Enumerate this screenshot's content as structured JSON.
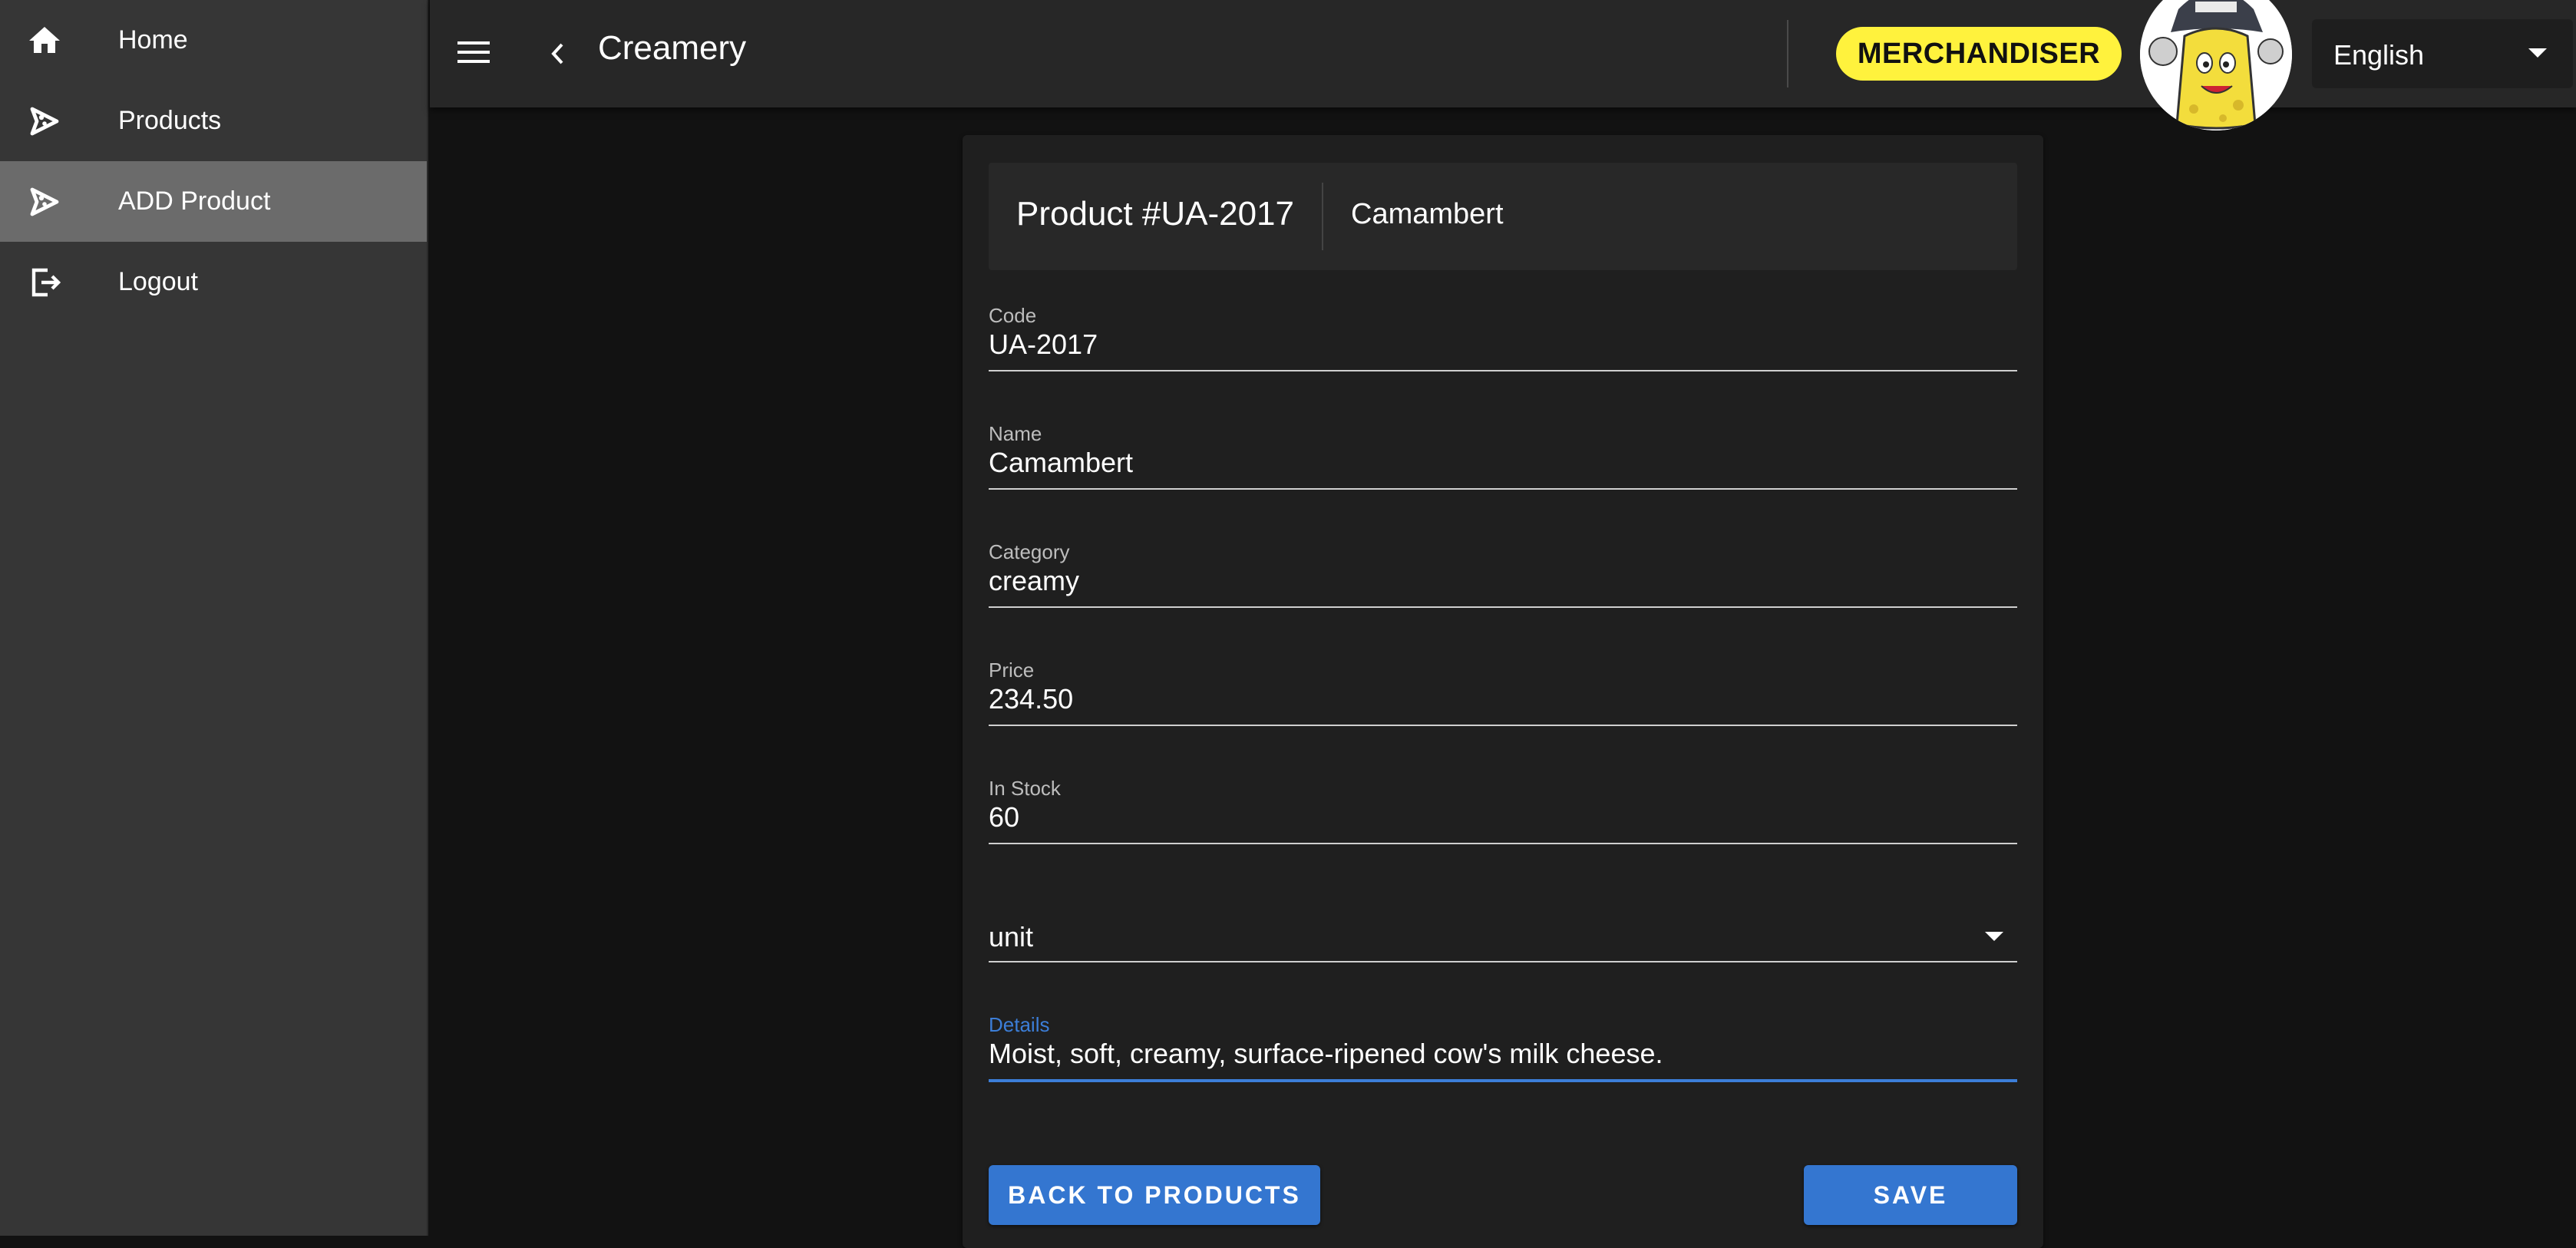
{
  "sidebar": {
    "items": [
      {
        "label": "Home",
        "icon": "home-icon"
      },
      {
        "label": "Products",
        "icon": "product-icon"
      },
      {
        "label": "ADD Product",
        "icon": "add-product-icon",
        "active": true
      },
      {
        "label": "Logout",
        "icon": "logout-icon"
      }
    ]
  },
  "header": {
    "title": "Creamery",
    "role_badge": "MERCHANDISER",
    "language": "English"
  },
  "form": {
    "header": {
      "product_no": "Product #UA-2017",
      "product_name": "Camambert"
    },
    "code": {
      "label": "Code",
      "value": "UA-2017"
    },
    "name": {
      "label": "Name",
      "value": "Camambert"
    },
    "category": {
      "label": "Category",
      "value": "creamy"
    },
    "price": {
      "label": "Price",
      "value": "234.50"
    },
    "in_stock": {
      "label": "In Stock",
      "value": "60"
    },
    "unit": {
      "value": "unit"
    },
    "details": {
      "label": "Details",
      "value": "Moist, soft, creamy, surface-ripened cow's milk cheese."
    },
    "back_label": "BACK TO PRODUCTS",
    "save_label": "SAVE"
  },
  "colors": {
    "accent": "#3476d0",
    "badge": "#fff23d",
    "sidebar_bg": "#363636",
    "topbar_bg": "#272727"
  }
}
